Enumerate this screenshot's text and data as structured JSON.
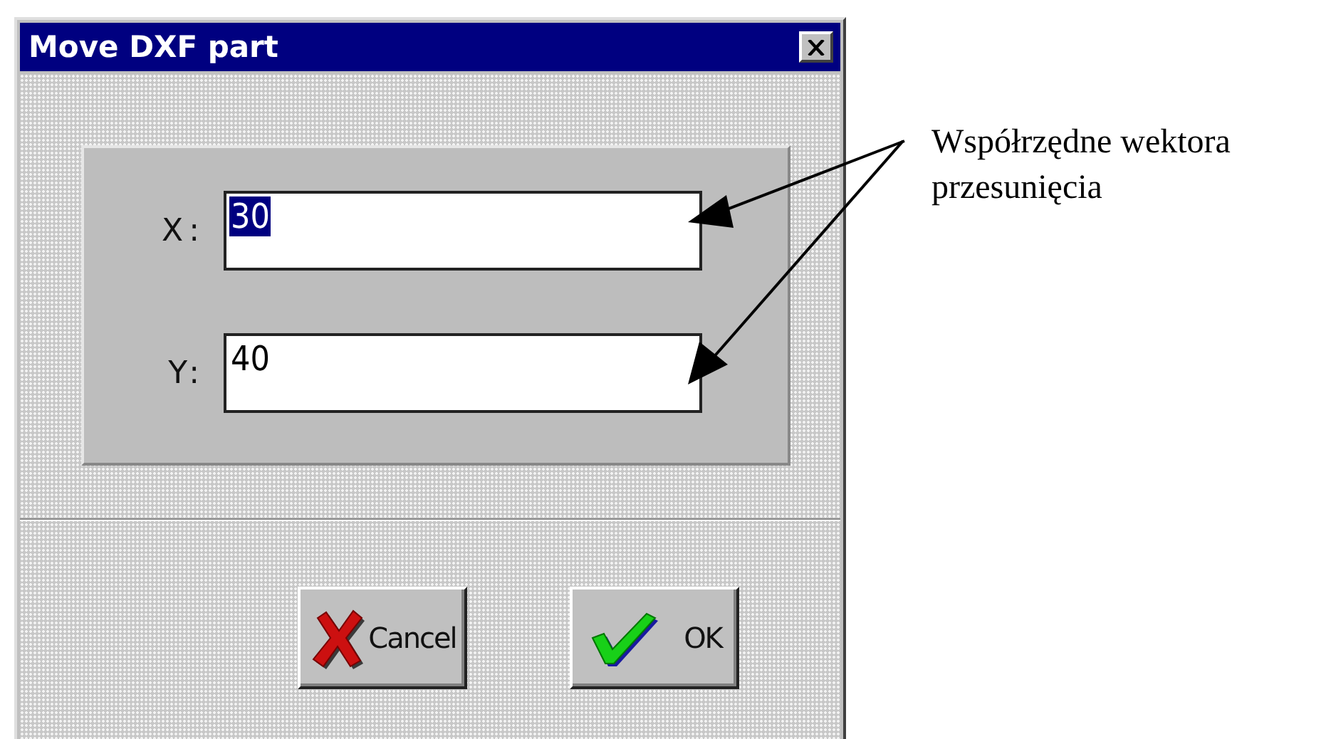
{
  "window": {
    "title": "Move DXF part"
  },
  "fields": [
    {
      "label": "X:",
      "value": "30",
      "selected": true
    },
    {
      "label": "Y:",
      "value": "40",
      "selected": false
    }
  ],
  "buttons": [
    {
      "label": "Cancel",
      "kind": "cancel"
    },
    {
      "label": "OK",
      "kind": "ok"
    }
  ],
  "annotation": {
    "lines": [
      "Współrzędne wektora",
      "przesunięcia"
    ]
  }
}
